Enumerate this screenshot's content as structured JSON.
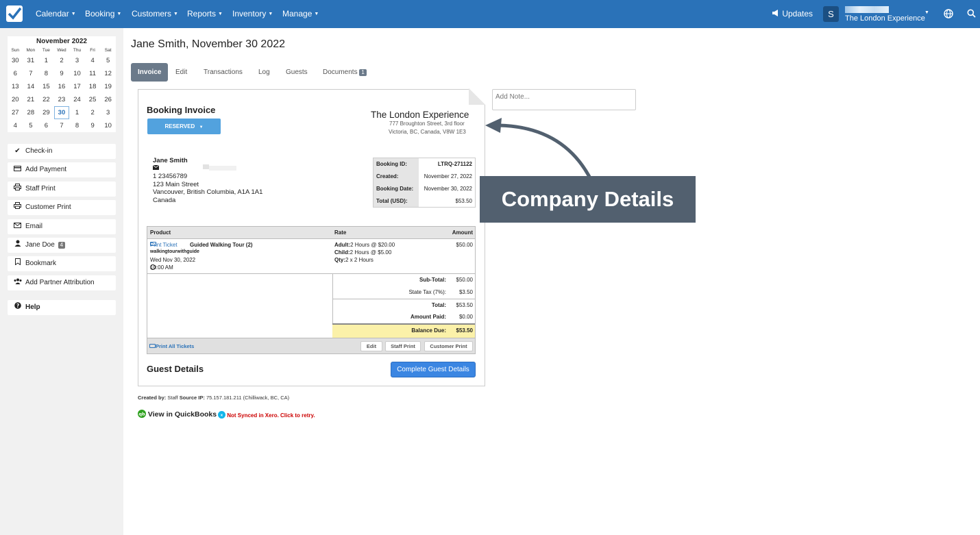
{
  "topbar": {
    "nav": [
      {
        "label": "Calendar"
      },
      {
        "label": "Booking"
      },
      {
        "label": "Customers"
      },
      {
        "label": "Reports"
      },
      {
        "label": "Inventory"
      },
      {
        "label": "Manage"
      }
    ],
    "updates_label": "Updates",
    "avatar_initial": "S",
    "account_name": "The London Experience"
  },
  "calendar": {
    "month_label": "November 2022",
    "weekdays": [
      "Sun",
      "Mon",
      "Tue",
      "Wed",
      "Thu",
      "Fri",
      "Sat"
    ],
    "days": [
      "30",
      "31",
      "1",
      "2",
      "3",
      "4",
      "5",
      "6",
      "7",
      "8",
      "9",
      "10",
      "11",
      "12",
      "13",
      "14",
      "15",
      "16",
      "17",
      "18",
      "19",
      "20",
      "21",
      "22",
      "23",
      "24",
      "25",
      "26",
      "27",
      "28",
      "29",
      "30",
      "1",
      "2",
      "3",
      "4",
      "5",
      "6",
      "7",
      "8",
      "9",
      "10"
    ],
    "today_index": 31
  },
  "sidebar": {
    "actions": [
      {
        "label": "Check-in",
        "icon": "check-icon"
      },
      {
        "label": "Add Payment",
        "icon": "credit-card-icon"
      },
      {
        "label": "Staff Print",
        "icon": "printer-icon"
      },
      {
        "label": "Customer Print",
        "icon": "printer-icon"
      },
      {
        "label": "Email",
        "icon": "envelope-icon"
      },
      {
        "label": "Jane Doe",
        "icon": "user-icon",
        "badge": "4"
      },
      {
        "label": "Bookmark",
        "icon": "bookmark-icon"
      },
      {
        "label": "Add Partner Attribution",
        "icon": "users-icon"
      }
    ],
    "help_label": "Help"
  },
  "page": {
    "title": "Jane Smith, November 30 2022",
    "tabs": [
      {
        "label": "Invoice"
      },
      {
        "label": "Edit"
      },
      {
        "label": "Transactions"
      },
      {
        "label": "Log"
      },
      {
        "label": "Guests"
      },
      {
        "label": "Documents",
        "badge": "1"
      }
    ],
    "note_placeholder": "Add Note..."
  },
  "invoice": {
    "heading": "Booking Invoice",
    "status": "RESERVED",
    "company": {
      "name": "The London Experience",
      "address_line1": "777 Broughton Street, 3rd floor",
      "address_line2": "Victoria, BC, Canada, V8W 1E3"
    },
    "customer": {
      "name": "Jane Smith",
      "phone": "1 23456789",
      "street": "123 Main Street",
      "city": "Vancouver, British Columbia, A1A 1A1",
      "country": "Canada"
    },
    "details": [
      {
        "label": "Booking ID:",
        "value": "LTRQ-271122"
      },
      {
        "label": "Created:",
        "value": "November 27, 2022"
      },
      {
        "label": "Booking Date:",
        "value": "November 30, 2022"
      },
      {
        "label": "Total (USD):",
        "value": "$53.50"
      }
    ],
    "table_headers": {
      "product": "Product",
      "rate": "Rate",
      "amount": "Amount"
    },
    "line_item": {
      "print_ticket": "Print Ticket",
      "product": "Guided Walking Tour (2)",
      "code": "walkingtourwithguide",
      "date": "Wed Nov 30, 2022",
      "time": "10:00 AM",
      "adult_label": "Adult:",
      "adult_rate": "2 Hours @ $20.00",
      "child_label": "Child:",
      "child_rate": "2 Hours @ $5.00",
      "qty_label": "Qty:",
      "qty": "2 x 2 Hours",
      "amount": "$50.00"
    },
    "totals": [
      {
        "label": "Sub-Total:",
        "value": "$50.00"
      },
      {
        "label": "State Tax (7%):",
        "value": "$3.50"
      },
      {
        "label": "Total:",
        "value": "$53.50"
      },
      {
        "label": "Amount Paid:",
        "value": "$0.00"
      },
      {
        "label": "Balance Due:",
        "value": "$53.50"
      }
    ],
    "print_all": "Print All Tickets",
    "footer_buttons": {
      "edit": "Edit",
      "staff_print": "Staff Print",
      "customer_print": "Customer Print"
    },
    "guest_details_heading": "Guest Details",
    "complete_guest_details": "Complete Guest Details"
  },
  "meta": {
    "created_by_label": "Created by:",
    "created_by": "Staff",
    "source_ip_label": "Source IP:",
    "source_ip": "75.157.181.211 (Chilliwack, BC, CA)",
    "quickbooks": "View in QuickBooks",
    "xero": "Not Synced in Xero. Click to retry."
  },
  "annotation": {
    "callout": "Company Details"
  },
  "colors": {
    "topbar": "#2a72b8",
    "reserved": "#52a2de",
    "balance_due": "#fbf1a9",
    "callout": "#52606f",
    "primary_button": "#3b86e2"
  }
}
